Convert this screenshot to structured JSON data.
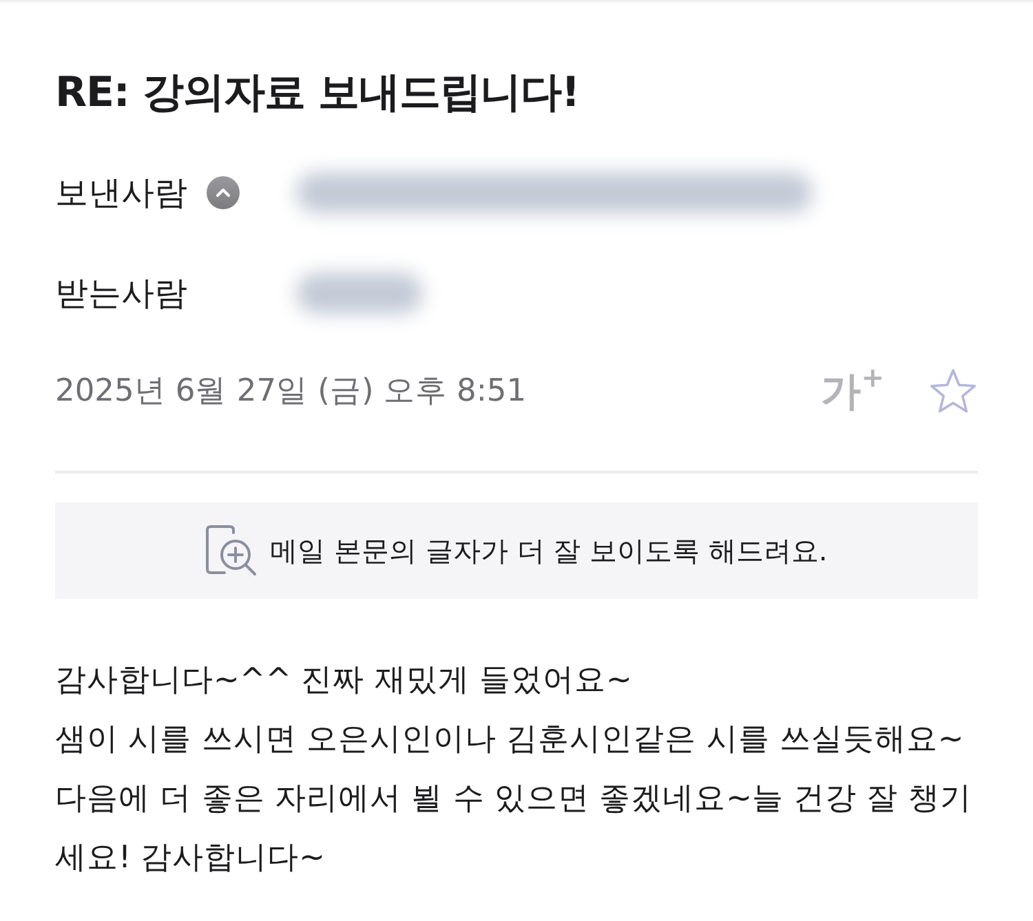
{
  "header": {
    "subject": "RE: 강의자료 보내드립니다!",
    "sender_label": "보낸사람",
    "sender_details_expanded": true,
    "recipient_label": "받는사람",
    "date": "2025년 6월 27일 (금) 오후 8:51",
    "text_size_button": "가$^{+}$",
    "starred": false
  },
  "readability_banner": {
    "text": "메일 본문의 글자가 더 잘 보이도록 해드려요."
  },
  "body": {
    "lines": [
      "감사합니다~^^ 진짜 재밌게 들었어요~",
      "샘이 시를 쓰시면 오은시인이나 김훈시인같은 시를 쓰실듯해요~",
      "다음에 더 좋은 자리에서 뵐 수 있으면 좋겠네요~늘 건강 잘 챙기",
      "세요! 감사합니다~"
    ]
  }
}
